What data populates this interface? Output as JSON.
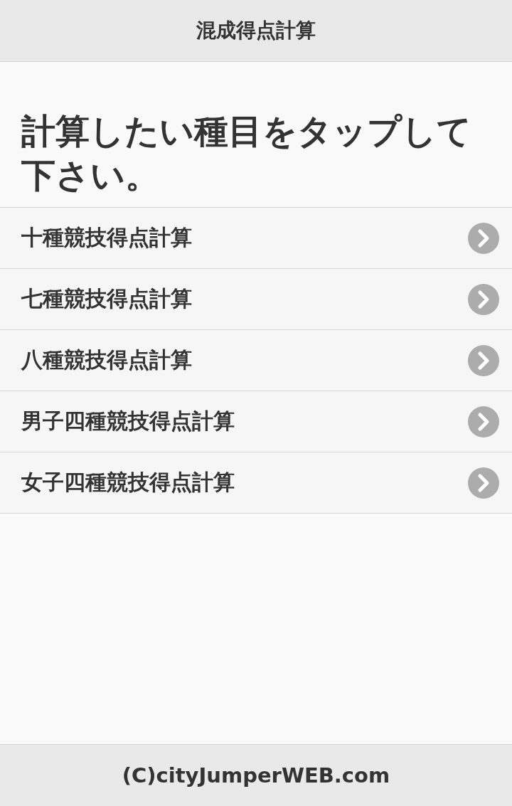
{
  "header": {
    "title": "混成得点計算"
  },
  "heading": "計算したい種目をタップして下さい。",
  "items": [
    {
      "label": "十種競技得点計算"
    },
    {
      "label": "七種競技得点計算"
    },
    {
      "label": "八種競技得点計算"
    },
    {
      "label": "男子四種競技得点計算"
    },
    {
      "label": "女子四種競技得点計算"
    }
  ],
  "footer": {
    "text": "(C)cityJumperWEB.com"
  }
}
